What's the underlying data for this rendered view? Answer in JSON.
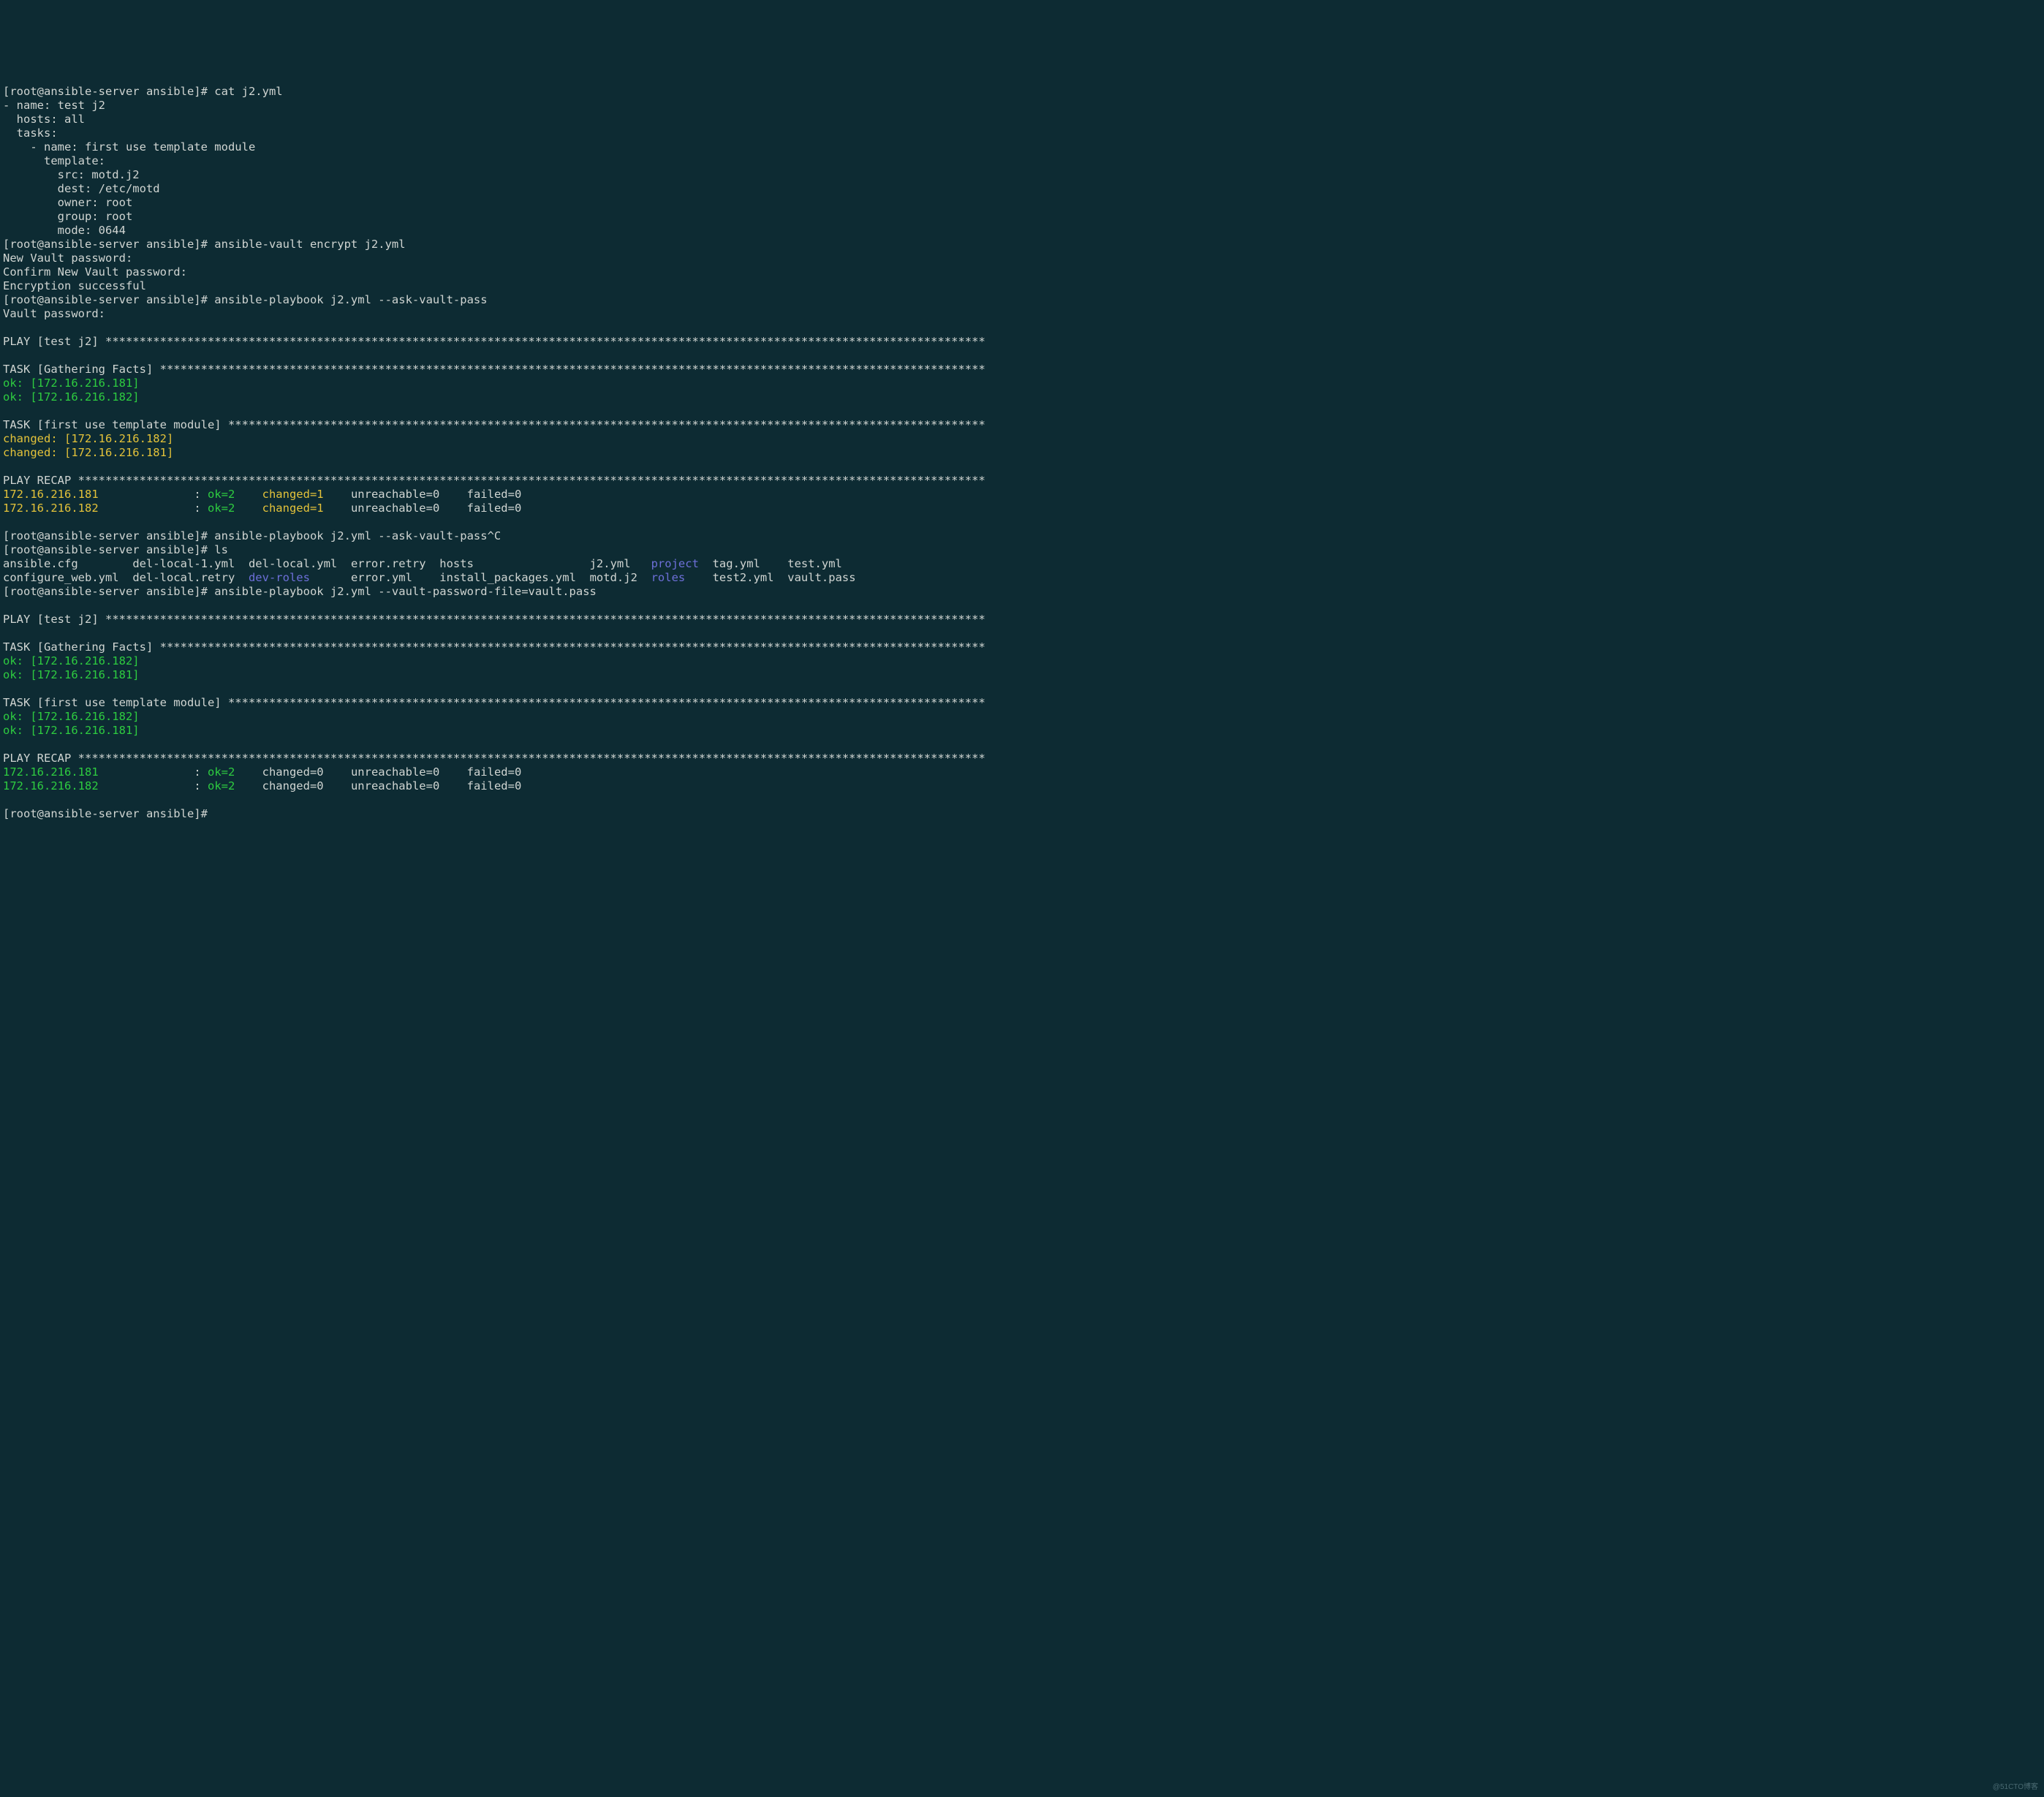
{
  "prompt": "[root@ansible-server ansible]# ",
  "cmds": {
    "cat": "cat j2.yml",
    "encrypt": "ansible-vault encrypt j2.yml",
    "play1": "ansible-playbook j2.yml --ask-vault-pass",
    "play1c": "ansible-playbook j2.yml --ask-vault-pass^C",
    "ls": "ls",
    "play2": "ansible-playbook j2.yml --vault-password-file=vault.pass"
  },
  "yaml": {
    "l1": "- name: test j2",
    "l2": "  hosts: all",
    "l3": "  tasks:",
    "l4": "    - name: first use template module",
    "l5": "      template:",
    "l6": "        src: motd.j2",
    "l7": "        dest: /etc/motd",
    "l8": "        owner: root",
    "l9": "        group: root",
    "l10": "        mode: 0644"
  },
  "vault": {
    "nvp": "New Vault password:",
    "cnvp": "Confirm New Vault password:",
    "succ": "Encryption successful",
    "vp": "Vault password:"
  },
  "headers": {
    "play": "PLAY [test j2] ",
    "gather": "TASK [Gathering Facts] ",
    "mod": "TASK [first use template module] ",
    "recap": "PLAY RECAP "
  },
  "stars": {
    "play": "*********************************************************************************************************************************",
    "gather": "*************************************************************************************************************************",
    "mod": "***************************************************************************************************************",
    "recap": "*************************************************************************************************************************************"
  },
  "hosts": {
    "ok181": "ok: [172.16.216.181]",
    "ok182": "ok: [172.16.216.182]",
    "ch181": "changed: [172.16.216.181]",
    "ch182": "changed: [172.16.216.182]"
  },
  "recap": {
    "h181": "172.16.216.181",
    "h182": "172.16.216.182",
    "pad": "             ",
    "colon": " : ",
    "ok2": "ok=2   ",
    "ch1": " changed=1   ",
    "ch0": " changed=0   ",
    "unr": " unreachable=0    ",
    "fail": "failed=0   "
  },
  "ls": {
    "r1c1": "ansible.cfg        ",
    "r1c2": "del-local-1.yml  ",
    "r1c3": "del-local.yml  ",
    "r1c4": "error.retry  ",
    "r1c5": "hosts                 ",
    "r1c6": "j2.yml   ",
    "r1c7": "project",
    "r1c8": "  tag.yml    ",
    "r1c9": "test.yml",
    "r2c1": "configure_web.yml  ",
    "r2c2": "del-local.retry  ",
    "r2c3": "dev-roles",
    "r2c3b": "      ",
    "r2c4": "error.yml    ",
    "r2c5": "install_packages.yml  ",
    "r2c6": "motd.j2  ",
    "r2c7": "roles",
    "r2c8": "    test2.yml  ",
    "r2c9": "vault.pass"
  },
  "watermark": "@51CTO博客"
}
